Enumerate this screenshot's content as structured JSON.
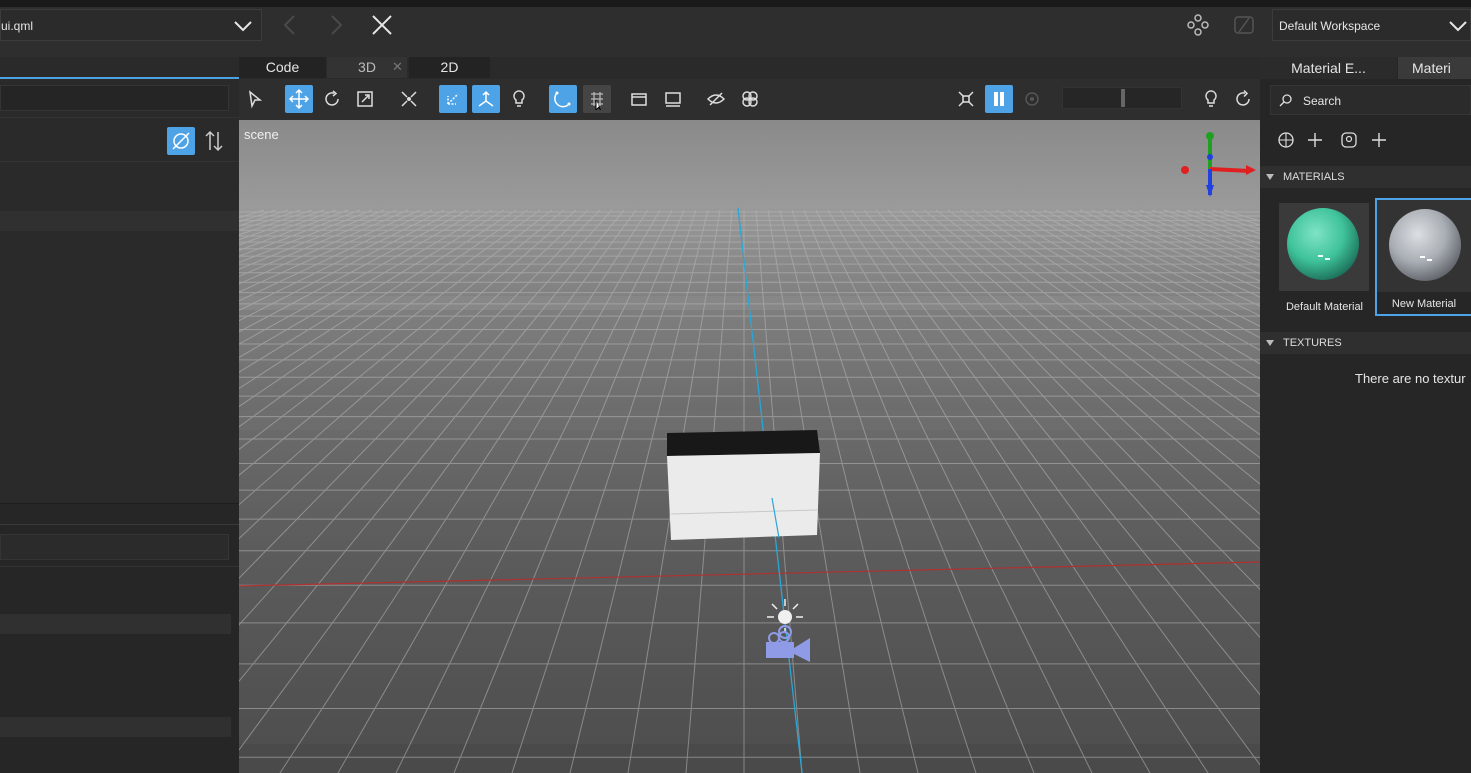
{
  "file": {
    "name": "ui.qml"
  },
  "workspace": {
    "selected": "Default Workspace"
  },
  "center": {
    "tabs": [
      "Code",
      "3D",
      "2D"
    ],
    "active_tab": "3D",
    "tab_close": "✕",
    "viewport_label": "scene"
  },
  "right": {
    "tabs": [
      "Material E...",
      "Materi"
    ],
    "search_placeholder": "Search",
    "materials_header": "MATERIALS",
    "materials": [
      {
        "name": "Default Material",
        "color": "#3fc39a",
        "selected": false
      },
      {
        "name": "New Material",
        "color": "#a9aeb4",
        "selected": true
      }
    ],
    "textures_header": "TEXTURES",
    "textures_empty": "There are no textur"
  },
  "colors": {
    "accent": "#4da3e6",
    "axis_x": "#e02020",
    "axis_y": "#20a020",
    "axis_z": "#2040e0",
    "camera": "#8f9be6"
  },
  "icons": {
    "top": [
      "back-icon",
      "forward-icon",
      "close-icon",
      "components-icon",
      "live-preview-icon"
    ],
    "center_toolbar": [
      "select-icon",
      "move-icon",
      "rotate-icon",
      "scale-icon",
      "fit-selected-icon",
      "local-orientation-icon",
      "global-orientation-icon",
      "light-icon",
      "snap-icon",
      "snap-config-icon",
      "edit-camera-icon",
      "align-view-icon",
      "visibility-icon",
      "particles-icon",
      "reset-view-icon",
      "pause-icon",
      "restart-particles-icon",
      "environment-light-icon",
      "refresh-icon"
    ]
  }
}
